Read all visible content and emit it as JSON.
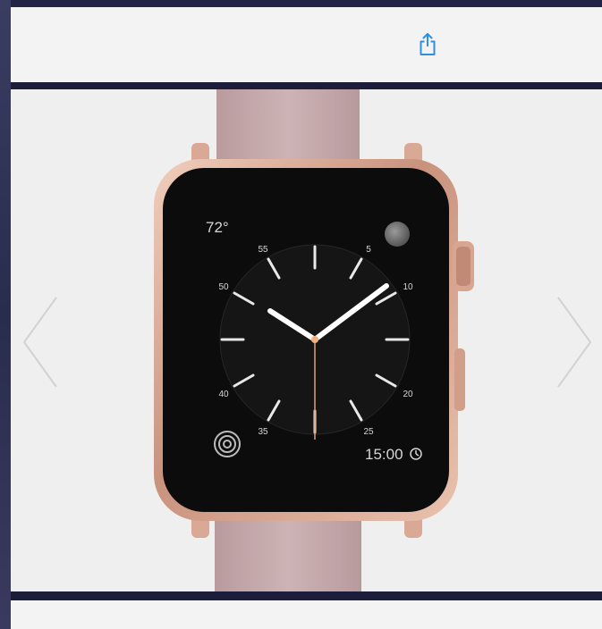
{
  "toolbar": {
    "share_icon": "share-icon"
  },
  "carousel": {
    "prev_icon": "chevron-left-icon",
    "next_icon": "chevron-right-icon"
  },
  "watch_face": {
    "temperature": "72°",
    "minute_labels": [
      "55",
      "5",
      "50",
      "10",
      "40",
      "20",
      "35",
      "25"
    ],
    "time": "15:00",
    "band_color": "#c9aeb0",
    "case_color": "#e3b8a4"
  }
}
